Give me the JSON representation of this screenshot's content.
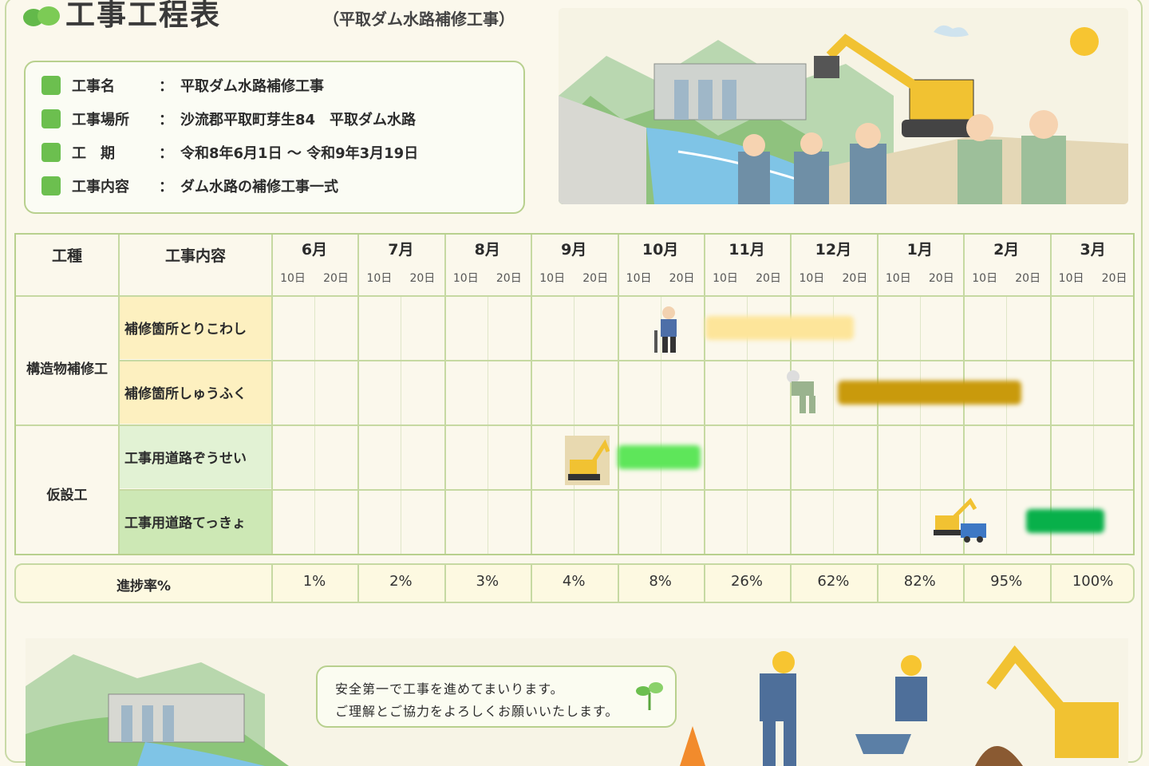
{
  "header": {
    "title": "工事工程表",
    "subtitle": "（平取ダム水路補修工事）"
  },
  "info": [
    {
      "label": "工事名",
      "colon": "：",
      "value": "平取ダム水路補修工事"
    },
    {
      "label": "工事場所",
      "colon": "：",
      "value": "沙流郡平取町芽生84　平取ダム水路"
    },
    {
      "label": "工　期",
      "colon": "：",
      "value": "令和8年6月1日 ～ 令和9年3月19日"
    },
    {
      "label": "工事内容",
      "colon": "：",
      "value": "ダム水路の補修工事一式"
    }
  ],
  "table": {
    "col_type": "工種",
    "col_content": "工事内容",
    "months": [
      "6月",
      "7月",
      "8月",
      "9月",
      "10月",
      "11月",
      "12月",
      "1月",
      "2月",
      "3月"
    ],
    "ticks": [
      "10日",
      "20日"
    ],
    "groups": [
      {
        "name": "構造物補修工",
        "tasks": [
          "補修箇所とりこわし",
          "補修箇所しゅうふく"
        ]
      },
      {
        "name": "仮設工",
        "tasks": [
          "工事用道路ぞうせい",
          "工事用道路てっきょ"
        ]
      }
    ]
  },
  "progress": {
    "label": "進捗率%",
    "values": [
      "1%",
      "2%",
      "3%",
      "4%",
      "8%",
      "26%",
      "62%",
      "82%",
      "95%",
      "100%"
    ]
  },
  "banner": {
    "message_line1": "安全第一で工事を進めてまいります。",
    "message_line2": "ご理解とご協力をよろしくお願いいたします。"
  },
  "colors": {
    "task1_bg": "#fdf0c0",
    "task2_bg": "#fdf0c0",
    "task3_bg": "#e2f2d4",
    "task4_bg": "#cde8b5",
    "bar_demolish": "#fde59a",
    "bar_repair": "#c99a0c",
    "bar_road_build": "#5ee65a",
    "bar_road_remove": "#08b04a"
  },
  "icons": [
    "leaf-logo-icon",
    "worker-jackhammer-icon",
    "worker-repair-icon",
    "excavator-icon",
    "excavator-truck-icon",
    "seedling-icon",
    "sun-icon"
  ]
}
